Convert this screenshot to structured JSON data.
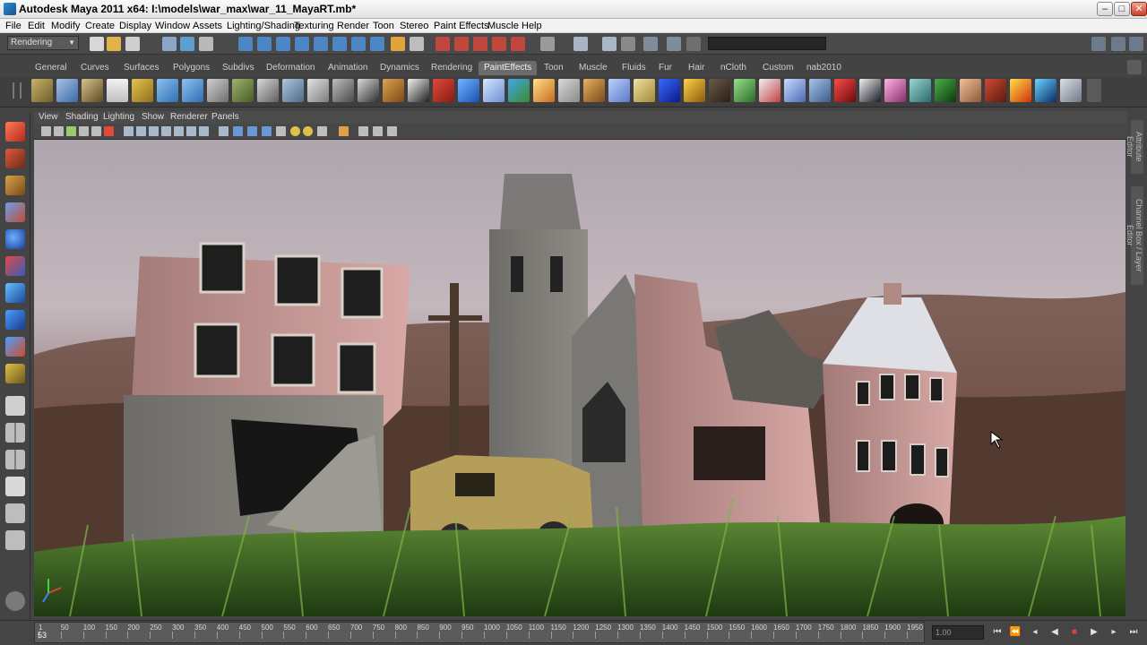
{
  "window": {
    "title": "Autodesk Maya 2011 x64: I:\\models\\war_max\\war_11_MayaRT.mb*",
    "controls": {
      "minimize": "–",
      "maximize": "□",
      "close": "✕"
    }
  },
  "menubar": [
    "File",
    "Edit",
    "Modify",
    "Create",
    "Display",
    "Window",
    "Assets",
    "Lighting/Shading",
    "Texturing",
    "Render",
    "Toon",
    "Stereo",
    "Paint Effects",
    "Muscle",
    "Help"
  ],
  "status_line": {
    "mode": "Rendering"
  },
  "shelf": {
    "tabs": [
      "General",
      "Curves",
      "Surfaces",
      "Polygons",
      "Subdivs",
      "Deformation",
      "Animation",
      "Dynamics",
      "Rendering",
      "PaintEffects",
      "Toon",
      "Muscle",
      "Fluids",
      "Fur",
      "Hair",
      "nCloth",
      "Custom",
      "nab2010"
    ],
    "active_tab": "PaintEffects"
  },
  "panel": {
    "menus": [
      "View",
      "Shading",
      "Lighting",
      "Show",
      "Renderer",
      "Panels"
    ]
  },
  "right_tabs": [
    "Attribute Editor",
    "Channel Box / Layer Editor"
  ],
  "timeslider": {
    "ticks": [
      "1",
      "50",
      "100",
      "150",
      "200",
      "250",
      "300",
      "350",
      "400",
      "450",
      "500",
      "550",
      "600",
      "650",
      "700",
      "750",
      "800",
      "850",
      "900",
      "950",
      "1000",
      "1050",
      "1100",
      "1150",
      "1200",
      "1250",
      "1300",
      "1350",
      "1400",
      "1450",
      "1500",
      "1550",
      "1600",
      "1650",
      "1700",
      "1750",
      "1800",
      "1850",
      "1900",
      "1950"
    ],
    "current_frame": "53",
    "frame_field": "1.00",
    "playback": [
      "⏮",
      "⏪",
      "◂",
      "◀",
      "■",
      "▶",
      "▸",
      "⏭"
    ]
  },
  "colors": {
    "accent": "#6c6c6c",
    "viewport_sky": "#c9c0c6",
    "ground": "#4d3a30"
  }
}
